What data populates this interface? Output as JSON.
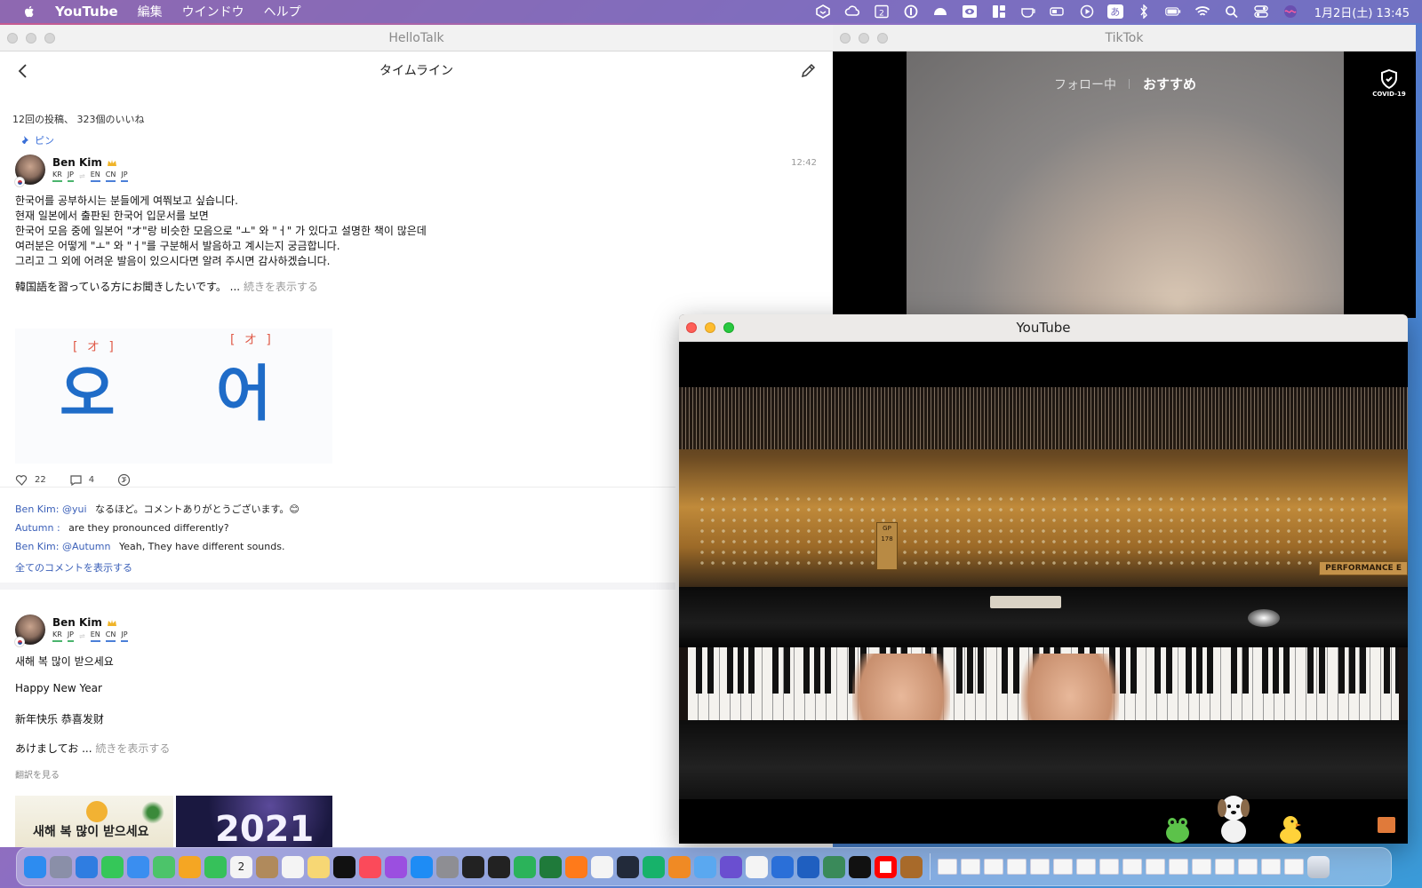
{
  "menubar": {
    "app_name": "YouTube",
    "menus": [
      "編集",
      "ウインドウ",
      "ヘルプ"
    ],
    "clock": "1月2日(土) 13:45",
    "status_icons": [
      "cube-icon",
      "creative-cloud-icon",
      "calendar-icon",
      "1password-icon",
      "cap-icon",
      "eye-icon",
      "dashboard-icon",
      "cup-icon",
      "battery-outline-icon",
      "play-circle-icon",
      "input-method-icon",
      "bluetooth-icon",
      "battery-icon",
      "wifi-icon",
      "spotlight-icon",
      "control-center-icon",
      "siri-icon"
    ],
    "calendar_day": "2",
    "input_method": "あ"
  },
  "hellotalk": {
    "window_title": "HelloTalk",
    "header_title": "タイムライン",
    "stats": "12回の投稿、 323個のいいね",
    "pin_label": "ピン",
    "posts": [
      {
        "user": "Ben Kim",
        "native_langs": [
          "KR",
          "JP"
        ],
        "learning_langs": [
          "EN",
          "CN",
          "JP"
        ],
        "time": "12:42",
        "text_lines": [
          "한국어를 공부하시는 분들에게 여쭤보고 싶습니다.",
          "현재 일본에서 출판된 한국어 입문서를 보면",
          "한국어 모음 중에 일본어 \"オ\"랑 비슷한 모음으로 \"ㅗ\" 와 \"ㅓ\" 가 있다고 설명한 책이 많은데",
          "여러분은 어떻게 \"ㅗ\" 와 \"ㅓ\"를 구분해서 발음하고 계시는지 궁금합니다.",
          "그리고 그 외에 어려운 발음이 있으시다면 알려 주시면 감사하겠습니다."
        ],
        "jp_line": "韓国語を習っている方にお聞きしたいです。 ...",
        "more_label": "続きを表示する",
        "image": {
          "left_reading": "[ オ ]",
          "left_char": "오",
          "right_reading": "[ オ ]",
          "right_char": "어"
        },
        "likes": "22",
        "comments_count": "4",
        "comments": [
          {
            "who": "Ben Kim: @yui",
            "text": "なるほど。コメントありがとうございます。😊"
          },
          {
            "who": "Autumn :",
            "text": "are they pronounced differently?"
          },
          {
            "who": "Ben Kim: @Autumn",
            "text": "Yeah, They have different sounds."
          }
        ],
        "show_all_comments": "全てのコメントを表示する"
      },
      {
        "user": "Ben Kim",
        "native_langs": [
          "KR",
          "JP"
        ],
        "learning_langs": [
          "EN",
          "CN",
          "JP"
        ],
        "lines": [
          "새해 복 많이 받으세요",
          "Happy New Year",
          "新年快乐 恭喜发财"
        ],
        "truncated_line": "あけましてお ...",
        "more_label": "続きを表示する",
        "translate_label": "翻訳を見る",
        "thumb1_text": "새해 복 많이 받으세요",
        "thumb2_text": "2021"
      }
    ]
  },
  "tiktok": {
    "window_title": "TikTok",
    "tab_following": "フォロー中",
    "tab_foryou": "おすすめ",
    "covid_label": "COVID-19"
  },
  "youtube": {
    "window_title": "YouTube",
    "gp_label": "GP 178",
    "brand_label": "PERFORMANCE E"
  },
  "dock": {
    "app_icons": [
      "finder-icon",
      "launchpad-icon",
      "safari-icon",
      "messages-icon",
      "mail-icon",
      "maps-icon",
      "photos-icon",
      "facetime-icon",
      "calendar-icon",
      "contacts-icon",
      "reminders-icon",
      "notes-icon",
      "apple-tv-icon",
      "music-icon",
      "podcasts-icon",
      "app-store-icon",
      "system-preferences-icon",
      "terminal-icon",
      "activity-icon",
      "numbers-icon",
      "excel-icon",
      "firefox-icon",
      "chrome-icon",
      "cube-icon",
      "grammarly-icon",
      "fe-icon",
      "drop-icon",
      "game-icon",
      "voice-memo-icon",
      "xcode-icon",
      "1password-icon",
      "vpn-icon",
      "tiktok-icon",
      "youtube-icon",
      "archive-icon"
    ],
    "calendar_day": "2",
    "minimized_count": 16,
    "colors": {
      "accent_blue": "#1f6cc8",
      "pin_blue": "#3a6fd8",
      "link_blue": "#3a5fb8",
      "reading_red": "#e05c4a"
    }
  }
}
